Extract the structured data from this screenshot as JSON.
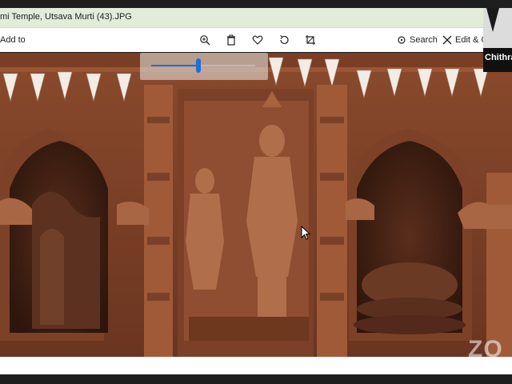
{
  "window": {
    "title": "mi Temple, Utsava Murti (43).JPG"
  },
  "toolbar": {
    "add_to_label": "Add to",
    "search_label": "Search",
    "edit_label": "Edit & Cre",
    "icons": [
      "zoom-in-icon",
      "delete-icon",
      "heart-icon",
      "rotate-icon",
      "crop-icon",
      "search-icon",
      "edit-icon"
    ]
  },
  "zoom": {
    "level_fraction": 0.45
  },
  "participant": {
    "name": "Chithra"
  },
  "watermark": {
    "text": "ZO"
  },
  "colors": {
    "accent": "#1f6fd6",
    "titlebar": "#e3ecd9",
    "wood": "#7a4027"
  }
}
